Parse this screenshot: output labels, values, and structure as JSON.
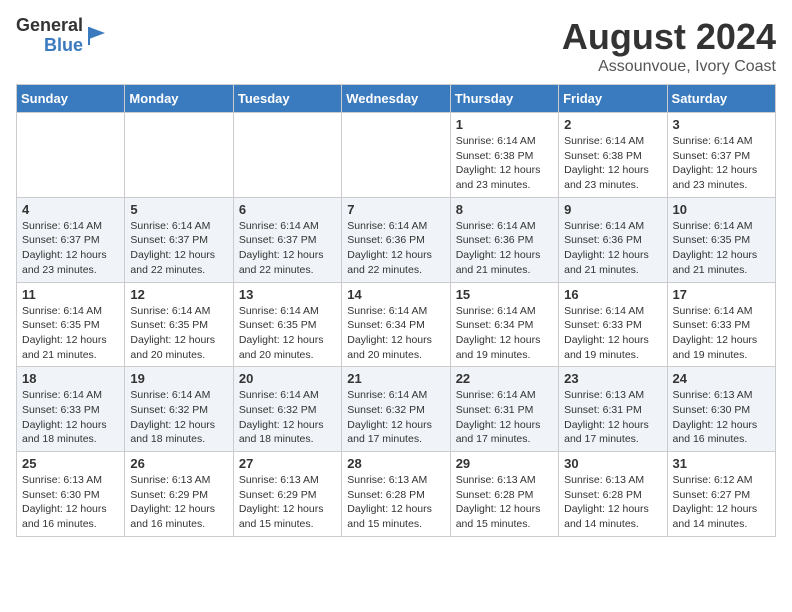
{
  "logo": {
    "line1": "General",
    "line2": "Blue"
  },
  "title": "August 2024",
  "location": "Assounvoue, Ivory Coast",
  "days_of_week": [
    "Sunday",
    "Monday",
    "Tuesday",
    "Wednesday",
    "Thursday",
    "Friday",
    "Saturday"
  ],
  "weeks": [
    [
      {
        "day": "",
        "info": ""
      },
      {
        "day": "",
        "info": ""
      },
      {
        "day": "",
        "info": ""
      },
      {
        "day": "",
        "info": ""
      },
      {
        "day": "1",
        "info": "Sunrise: 6:14 AM\nSunset: 6:38 PM\nDaylight: 12 hours\nand 23 minutes."
      },
      {
        "day": "2",
        "info": "Sunrise: 6:14 AM\nSunset: 6:38 PM\nDaylight: 12 hours\nand 23 minutes."
      },
      {
        "day": "3",
        "info": "Sunrise: 6:14 AM\nSunset: 6:37 PM\nDaylight: 12 hours\nand 23 minutes."
      }
    ],
    [
      {
        "day": "4",
        "info": "Sunrise: 6:14 AM\nSunset: 6:37 PM\nDaylight: 12 hours\nand 23 minutes."
      },
      {
        "day": "5",
        "info": "Sunrise: 6:14 AM\nSunset: 6:37 PM\nDaylight: 12 hours\nand 22 minutes."
      },
      {
        "day": "6",
        "info": "Sunrise: 6:14 AM\nSunset: 6:37 PM\nDaylight: 12 hours\nand 22 minutes."
      },
      {
        "day": "7",
        "info": "Sunrise: 6:14 AM\nSunset: 6:36 PM\nDaylight: 12 hours\nand 22 minutes."
      },
      {
        "day": "8",
        "info": "Sunrise: 6:14 AM\nSunset: 6:36 PM\nDaylight: 12 hours\nand 21 minutes."
      },
      {
        "day": "9",
        "info": "Sunrise: 6:14 AM\nSunset: 6:36 PM\nDaylight: 12 hours\nand 21 minutes."
      },
      {
        "day": "10",
        "info": "Sunrise: 6:14 AM\nSunset: 6:35 PM\nDaylight: 12 hours\nand 21 minutes."
      }
    ],
    [
      {
        "day": "11",
        "info": "Sunrise: 6:14 AM\nSunset: 6:35 PM\nDaylight: 12 hours\nand 21 minutes."
      },
      {
        "day": "12",
        "info": "Sunrise: 6:14 AM\nSunset: 6:35 PM\nDaylight: 12 hours\nand 20 minutes."
      },
      {
        "day": "13",
        "info": "Sunrise: 6:14 AM\nSunset: 6:35 PM\nDaylight: 12 hours\nand 20 minutes."
      },
      {
        "day": "14",
        "info": "Sunrise: 6:14 AM\nSunset: 6:34 PM\nDaylight: 12 hours\nand 20 minutes."
      },
      {
        "day": "15",
        "info": "Sunrise: 6:14 AM\nSunset: 6:34 PM\nDaylight: 12 hours\nand 19 minutes."
      },
      {
        "day": "16",
        "info": "Sunrise: 6:14 AM\nSunset: 6:33 PM\nDaylight: 12 hours\nand 19 minutes."
      },
      {
        "day": "17",
        "info": "Sunrise: 6:14 AM\nSunset: 6:33 PM\nDaylight: 12 hours\nand 19 minutes."
      }
    ],
    [
      {
        "day": "18",
        "info": "Sunrise: 6:14 AM\nSunset: 6:33 PM\nDaylight: 12 hours\nand 18 minutes."
      },
      {
        "day": "19",
        "info": "Sunrise: 6:14 AM\nSunset: 6:32 PM\nDaylight: 12 hours\nand 18 minutes."
      },
      {
        "day": "20",
        "info": "Sunrise: 6:14 AM\nSunset: 6:32 PM\nDaylight: 12 hours\nand 18 minutes."
      },
      {
        "day": "21",
        "info": "Sunrise: 6:14 AM\nSunset: 6:32 PM\nDaylight: 12 hours\nand 17 minutes."
      },
      {
        "day": "22",
        "info": "Sunrise: 6:14 AM\nSunset: 6:31 PM\nDaylight: 12 hours\nand 17 minutes."
      },
      {
        "day": "23",
        "info": "Sunrise: 6:13 AM\nSunset: 6:31 PM\nDaylight: 12 hours\nand 17 minutes."
      },
      {
        "day": "24",
        "info": "Sunrise: 6:13 AM\nSunset: 6:30 PM\nDaylight: 12 hours\nand 16 minutes."
      }
    ],
    [
      {
        "day": "25",
        "info": "Sunrise: 6:13 AM\nSunset: 6:30 PM\nDaylight: 12 hours\nand 16 minutes."
      },
      {
        "day": "26",
        "info": "Sunrise: 6:13 AM\nSunset: 6:29 PM\nDaylight: 12 hours\nand 16 minutes."
      },
      {
        "day": "27",
        "info": "Sunrise: 6:13 AM\nSunset: 6:29 PM\nDaylight: 12 hours\nand 15 minutes."
      },
      {
        "day": "28",
        "info": "Sunrise: 6:13 AM\nSunset: 6:28 PM\nDaylight: 12 hours\nand 15 minutes."
      },
      {
        "day": "29",
        "info": "Sunrise: 6:13 AM\nSunset: 6:28 PM\nDaylight: 12 hours\nand 15 minutes."
      },
      {
        "day": "30",
        "info": "Sunrise: 6:13 AM\nSunset: 6:28 PM\nDaylight: 12 hours\nand 14 minutes."
      },
      {
        "day": "31",
        "info": "Sunrise: 6:12 AM\nSunset: 6:27 PM\nDaylight: 12 hours\nand 14 minutes."
      }
    ]
  ]
}
